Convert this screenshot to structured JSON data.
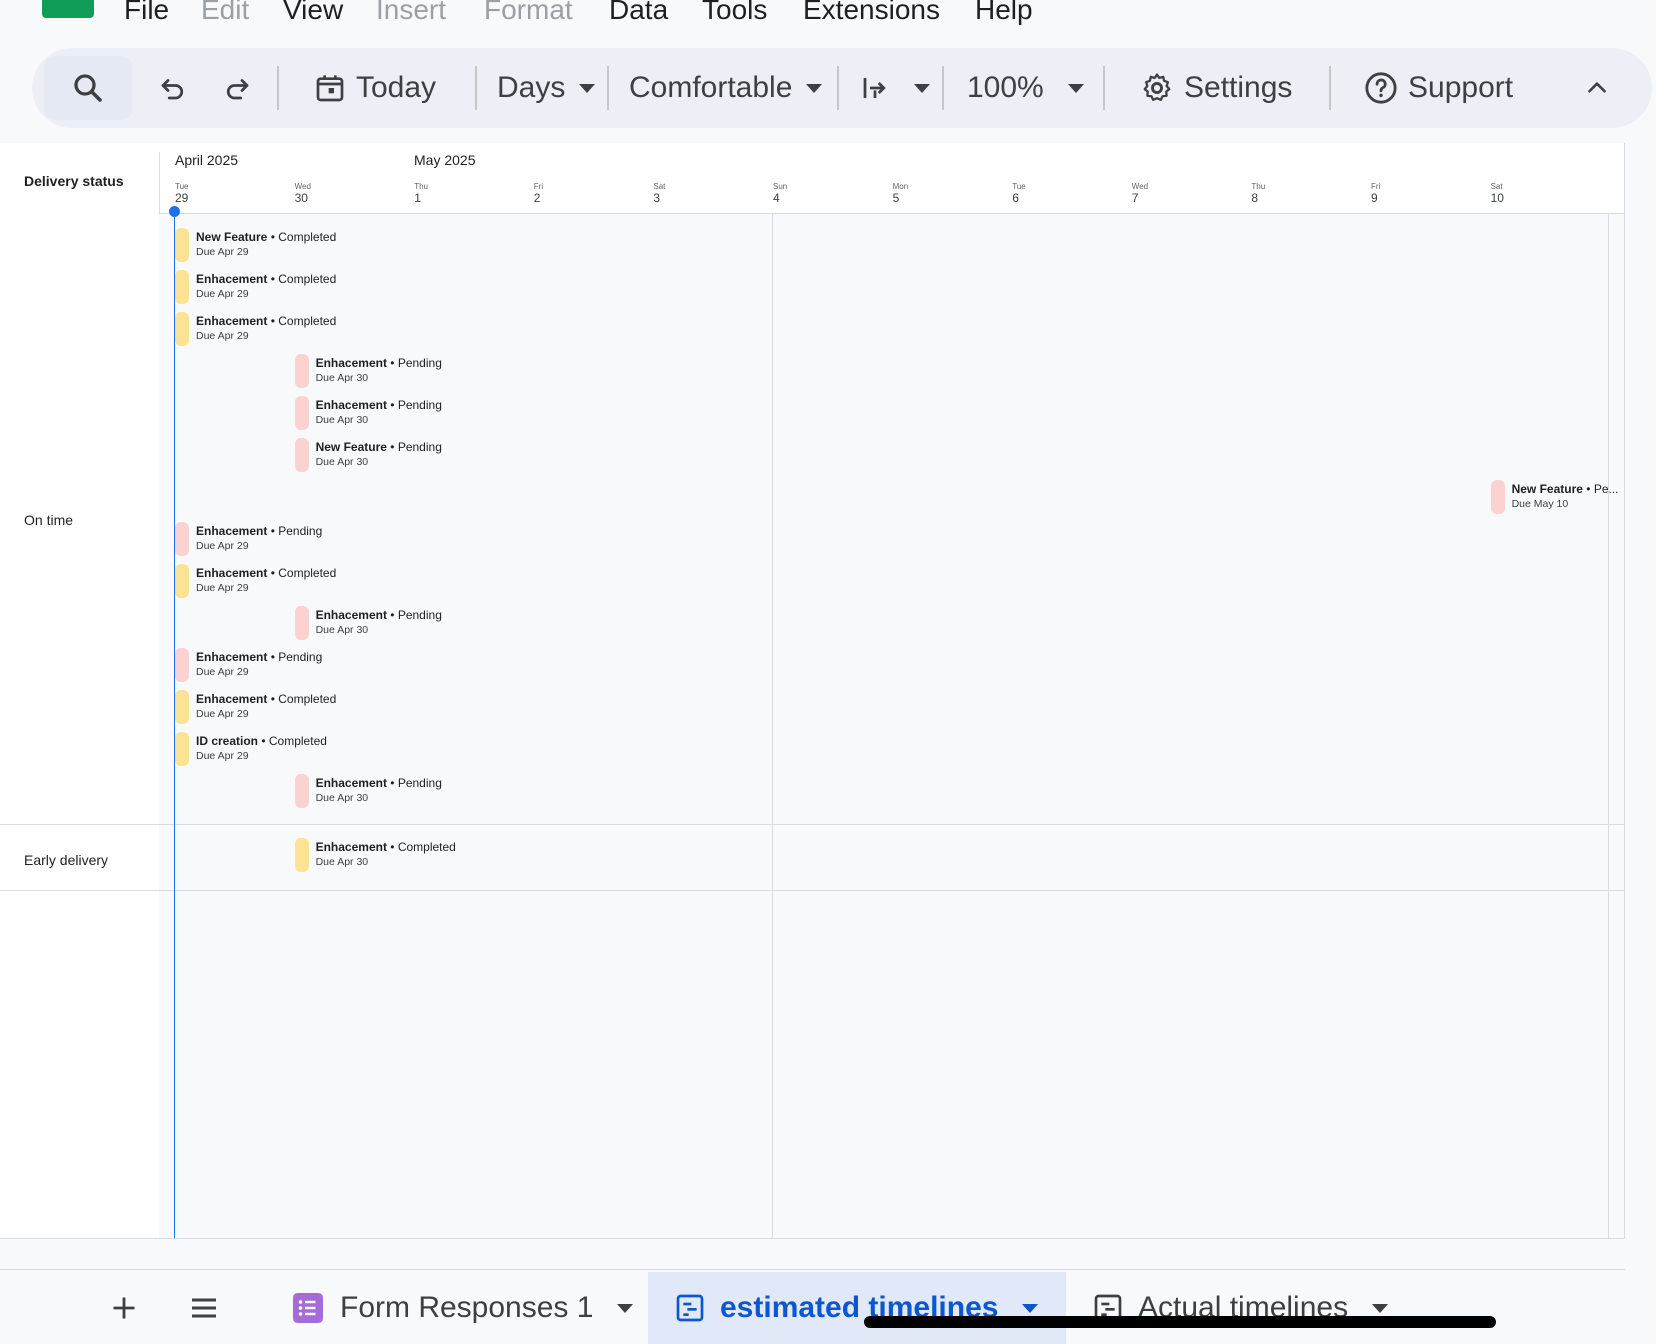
{
  "menu": [
    "File",
    "Edit",
    "View",
    "Insert",
    "Format",
    "Data",
    "Tools",
    "Extensions",
    "Help"
  ],
  "menu_disabled": [
    "Edit",
    "Insert",
    "Format"
  ],
  "toolbar": {
    "today": "Today",
    "days": "Days",
    "density": "Comfortable",
    "zoom": "100%",
    "settings": "Settings",
    "support": "Support"
  },
  "timeline": {
    "row_header": "Delivery status",
    "months": [
      "April 2025",
      "May 2025"
    ],
    "days": [
      {
        "dow": "Tue",
        "num": "29"
      },
      {
        "dow": "Wed",
        "num": "30"
      },
      {
        "dow": "Thu",
        "num": "1"
      },
      {
        "dow": "Fri",
        "num": "2"
      },
      {
        "dow": "Sat",
        "num": "3"
      },
      {
        "dow": "Sun",
        "num": "4"
      },
      {
        "dow": "Mon",
        "num": "5"
      },
      {
        "dow": "Tue",
        "num": "6"
      },
      {
        "dow": "Wed",
        "num": "7"
      },
      {
        "dow": "Thu",
        "num": "8"
      },
      {
        "dow": "Fri",
        "num": "9"
      },
      {
        "dow": "Sat",
        "num": "10"
      }
    ],
    "groups": [
      {
        "label": "On time",
        "cards": [
          {
            "title": "New Feature",
            "status": "Completed",
            "due": "Due Apr 29",
            "day": 0
          },
          {
            "title": "Enhacement",
            "status": "Completed",
            "due": "Due Apr 29",
            "day": 0
          },
          {
            "title": "Enhacement",
            "status": "Completed",
            "due": "Due Apr 29",
            "day": 0
          },
          {
            "title": "Enhacement",
            "status": "Pending",
            "due": "Due Apr 30",
            "day": 1
          },
          {
            "title": "Enhacement",
            "status": "Pending",
            "due": "Due Apr 30",
            "day": 1
          },
          {
            "title": "New Feature",
            "status": "Pending",
            "due": "Due Apr 30",
            "day": 1
          },
          {
            "title": "New Feature",
            "status": "Pe...",
            "due": "Due May 10",
            "day": 11
          },
          {
            "title": "Enhacement",
            "status": "Pending",
            "due": "Due Apr 29",
            "day": 0
          },
          {
            "title": "Enhacement",
            "status": "Completed",
            "due": "Due Apr 29",
            "day": 0
          },
          {
            "title": "Enhacement",
            "status": "Pending",
            "due": "Due Apr 30",
            "day": 1
          },
          {
            "title": "Enhacement",
            "status": "Pending",
            "due": "Due Apr 29",
            "day": 0
          },
          {
            "title": "Enhacement",
            "status": "Completed",
            "due": "Due Apr 29",
            "day": 0
          },
          {
            "title": "ID creation",
            "status": "Completed",
            "due": "Due Apr 29",
            "day": 0
          },
          {
            "title": "Enhacement",
            "status": "Pending",
            "due": "Due Apr 30",
            "day": 1
          }
        ]
      },
      {
        "label": "Early delivery",
        "cards": [
          {
            "title": "Enhacement",
            "status": "Completed",
            "due": "Due Apr 30",
            "day": 1
          }
        ]
      }
    ],
    "colors": {
      "completed": "#fde293",
      "pending": "#fbd2cf",
      "today_line": "#1a73e8"
    }
  },
  "tabs": [
    {
      "label": "Form Responses 1",
      "icon": "form-icon"
    },
    {
      "label": "estimated timelines",
      "icon": "timeline-icon",
      "active": true
    },
    {
      "label": "Actual timelines",
      "icon": "timeline-icon"
    }
  ]
}
